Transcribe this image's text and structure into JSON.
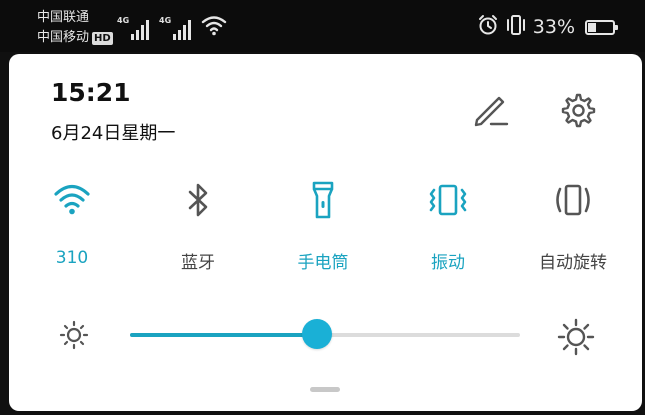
{
  "statusbar": {
    "carrier1": "中国联通",
    "carrier2": "中国移动",
    "hd_badge": "HD",
    "network1": "4G",
    "network2": "4G",
    "battery_percent": "33%",
    "battery_level": 0.33,
    "icons": [
      "alarm-icon",
      "vibrate-icon",
      "battery-icon",
      "wifi-icon",
      "signal-icon"
    ]
  },
  "header": {
    "time": "15:21",
    "date": "6月24日星期一",
    "icons": [
      "edit-icon",
      "settings-icon"
    ]
  },
  "tiles": [
    {
      "label": "310",
      "icon": "wifi-icon",
      "active": true
    },
    {
      "label": "蓝牙",
      "icon": "bluetooth-icon",
      "active": false
    },
    {
      "label": "手电筒",
      "icon": "flashlight-icon",
      "active": true
    },
    {
      "label": "振动",
      "icon": "vibrate-icon",
      "active": true
    },
    {
      "label": "自动旋转",
      "icon": "auto-rotate-icon",
      "active": false
    }
  ],
  "brightness": {
    "level": 0.48,
    "icons": [
      "brightness-low-icon",
      "brightness-high-icon"
    ]
  },
  "colors": {
    "accent": "#1aa3c0",
    "panel_bg": "#ffffff",
    "statusbar_bg": "#0c0c0c",
    "inactive_icon": "#555555"
  }
}
